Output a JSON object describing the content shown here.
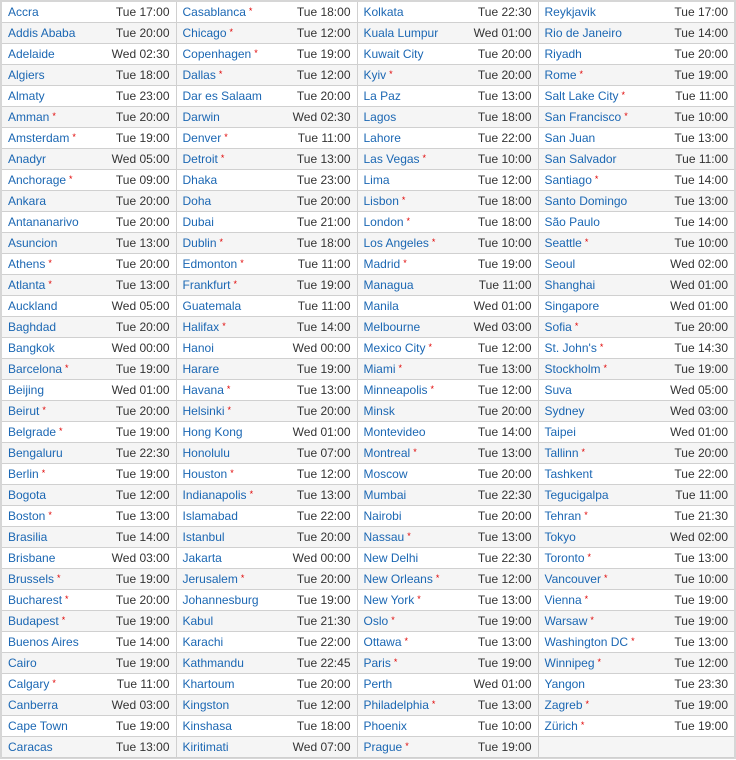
{
  "dst_marker": "*",
  "colors": {
    "link": "#1b67b3",
    "dst_marker": "#e00000",
    "row_alt": "#f5f5f5",
    "border": "#d0d0d0"
  },
  "columns": [
    [
      [
        "Accra",
        "Tue 17:00",
        false
      ],
      [
        "Addis Ababa",
        "Tue 20:00",
        false
      ],
      [
        "Adelaide",
        "Wed 02:30",
        false
      ],
      [
        "Algiers",
        "Tue 18:00",
        false
      ],
      [
        "Almaty",
        "Tue 23:00",
        false
      ],
      [
        "Amman",
        "Tue 20:00",
        true
      ],
      [
        "Amsterdam",
        "Tue 19:00",
        true
      ],
      [
        "Anadyr",
        "Wed 05:00",
        false
      ],
      [
        "Anchorage",
        "Tue 09:00",
        true
      ],
      [
        "Ankara",
        "Tue 20:00",
        false
      ],
      [
        "Antananarivo",
        "Tue 20:00",
        false
      ],
      [
        "Asuncion",
        "Tue 13:00",
        false
      ],
      [
        "Athens",
        "Tue 20:00",
        true
      ],
      [
        "Atlanta",
        "Tue 13:00",
        true
      ],
      [
        "Auckland",
        "Wed 05:00",
        false
      ],
      [
        "Baghdad",
        "Tue 20:00",
        false
      ],
      [
        "Bangkok",
        "Wed 00:00",
        false
      ],
      [
        "Barcelona",
        "Tue 19:00",
        true
      ],
      [
        "Beijing",
        "Wed 01:00",
        false
      ],
      [
        "Beirut",
        "Tue 20:00",
        true
      ],
      [
        "Belgrade",
        "Tue 19:00",
        true
      ],
      [
        "Bengaluru",
        "Tue 22:30",
        false
      ],
      [
        "Berlin",
        "Tue 19:00",
        true
      ],
      [
        "Bogota",
        "Tue 12:00",
        false
      ],
      [
        "Boston",
        "Tue 13:00",
        true
      ],
      [
        "Brasilia",
        "Tue 14:00",
        false
      ],
      [
        "Brisbane",
        "Wed 03:00",
        false
      ],
      [
        "Brussels",
        "Tue 19:00",
        true
      ],
      [
        "Bucharest",
        "Tue 20:00",
        true
      ],
      [
        "Budapest",
        "Tue 19:00",
        true
      ],
      [
        "Buenos Aires",
        "Tue 14:00",
        false
      ],
      [
        "Cairo",
        "Tue 19:00",
        false
      ],
      [
        "Calgary",
        "Tue 11:00",
        true
      ],
      [
        "Canberra",
        "Wed 03:00",
        false
      ],
      [
        "Cape Town",
        "Tue 19:00",
        false
      ],
      [
        "Caracas",
        "Tue 13:00",
        false
      ]
    ],
    [
      [
        "Casablanca",
        "Tue 18:00",
        true
      ],
      [
        "Chicago",
        "Tue 12:00",
        true
      ],
      [
        "Copenhagen",
        "Tue 19:00",
        true
      ],
      [
        "Dallas",
        "Tue 12:00",
        true
      ],
      [
        "Dar es Salaam",
        "Tue 20:00",
        false
      ],
      [
        "Darwin",
        "Wed 02:30",
        false
      ],
      [
        "Denver",
        "Tue 11:00",
        true
      ],
      [
        "Detroit",
        "Tue 13:00",
        true
      ],
      [
        "Dhaka",
        "Tue 23:00",
        false
      ],
      [
        "Doha",
        "Tue 20:00",
        false
      ],
      [
        "Dubai",
        "Tue 21:00",
        false
      ],
      [
        "Dublin",
        "Tue 18:00",
        true
      ],
      [
        "Edmonton",
        "Tue 11:00",
        true
      ],
      [
        "Frankfurt",
        "Tue 19:00",
        true
      ],
      [
        "Guatemala",
        "Tue 11:00",
        false
      ],
      [
        "Halifax",
        "Tue 14:00",
        true
      ],
      [
        "Hanoi",
        "Wed 00:00",
        false
      ],
      [
        "Harare",
        "Tue 19:00",
        false
      ],
      [
        "Havana",
        "Tue 13:00",
        true
      ],
      [
        "Helsinki",
        "Tue 20:00",
        true
      ],
      [
        "Hong Kong",
        "Wed 01:00",
        false
      ],
      [
        "Honolulu",
        "Tue 07:00",
        false
      ],
      [
        "Houston",
        "Tue 12:00",
        true
      ],
      [
        "Indianapolis",
        "Tue 13:00",
        true
      ],
      [
        "Islamabad",
        "Tue 22:00",
        false
      ],
      [
        "Istanbul",
        "Tue 20:00",
        false
      ],
      [
        "Jakarta",
        "Wed 00:00",
        false
      ],
      [
        "Jerusalem",
        "Tue 20:00",
        true
      ],
      [
        "Johannesburg",
        "Tue 19:00",
        false
      ],
      [
        "Kabul",
        "Tue 21:30",
        false
      ],
      [
        "Karachi",
        "Tue 22:00",
        false
      ],
      [
        "Kathmandu",
        "Tue 22:45",
        false
      ],
      [
        "Khartoum",
        "Tue 20:00",
        false
      ],
      [
        "Kingston",
        "Tue 12:00",
        false
      ],
      [
        "Kinshasa",
        "Tue 18:00",
        false
      ],
      [
        "Kiritimati",
        "Wed 07:00",
        false
      ]
    ],
    [
      [
        "Kolkata",
        "Tue 22:30",
        false
      ],
      [
        "Kuala Lumpur",
        "Wed 01:00",
        false
      ],
      [
        "Kuwait City",
        "Tue 20:00",
        false
      ],
      [
        "Kyiv",
        "Tue 20:00",
        true
      ],
      [
        "La Paz",
        "Tue 13:00",
        false
      ],
      [
        "Lagos",
        "Tue 18:00",
        false
      ],
      [
        "Lahore",
        "Tue 22:00",
        false
      ],
      [
        "Las Vegas",
        "Tue 10:00",
        true
      ],
      [
        "Lima",
        "Tue 12:00",
        false
      ],
      [
        "Lisbon",
        "Tue 18:00",
        true
      ],
      [
        "London",
        "Tue 18:00",
        true
      ],
      [
        "Los Angeles",
        "Tue 10:00",
        true
      ],
      [
        "Madrid",
        "Tue 19:00",
        true
      ],
      [
        "Managua",
        "Tue 11:00",
        false
      ],
      [
        "Manila",
        "Wed 01:00",
        false
      ],
      [
        "Melbourne",
        "Wed 03:00",
        false
      ],
      [
        "Mexico City",
        "Tue 12:00",
        true
      ],
      [
        "Miami",
        "Tue 13:00",
        true
      ],
      [
        "Minneapolis",
        "Tue 12:00",
        true
      ],
      [
        "Minsk",
        "Tue 20:00",
        false
      ],
      [
        "Montevideo",
        "Tue 14:00",
        false
      ],
      [
        "Montreal",
        "Tue 13:00",
        true
      ],
      [
        "Moscow",
        "Tue 20:00",
        false
      ],
      [
        "Mumbai",
        "Tue 22:30",
        false
      ],
      [
        "Nairobi",
        "Tue 20:00",
        false
      ],
      [
        "Nassau",
        "Tue 13:00",
        true
      ],
      [
        "New Delhi",
        "Tue 22:30",
        false
      ],
      [
        "New Orleans",
        "Tue 12:00",
        true
      ],
      [
        "New York",
        "Tue 13:00",
        true
      ],
      [
        "Oslo",
        "Tue 19:00",
        true
      ],
      [
        "Ottawa",
        "Tue 13:00",
        true
      ],
      [
        "Paris",
        "Tue 19:00",
        true
      ],
      [
        "Perth",
        "Wed 01:00",
        false
      ],
      [
        "Philadelphia",
        "Tue 13:00",
        true
      ],
      [
        "Phoenix",
        "Tue 10:00",
        false
      ],
      [
        "Prague",
        "Tue 19:00",
        true
      ]
    ],
    [
      [
        "Reykjavik",
        "Tue 17:00",
        false
      ],
      [
        "Rio de Janeiro",
        "Tue 14:00",
        false
      ],
      [
        "Riyadh",
        "Tue 20:00",
        false
      ],
      [
        "Rome",
        "Tue 19:00",
        true
      ],
      [
        "Salt Lake City",
        "Tue 11:00",
        true
      ],
      [
        "San Francisco",
        "Tue 10:00",
        true
      ],
      [
        "San Juan",
        "Tue 13:00",
        false
      ],
      [
        "San Salvador",
        "Tue 11:00",
        false
      ],
      [
        "Santiago",
        "Tue 14:00",
        true
      ],
      [
        "Santo Domingo",
        "Tue 13:00",
        false
      ],
      [
        "São Paulo",
        "Tue 14:00",
        false
      ],
      [
        "Seattle",
        "Tue 10:00",
        true
      ],
      [
        "Seoul",
        "Wed 02:00",
        false
      ],
      [
        "Shanghai",
        "Wed 01:00",
        false
      ],
      [
        "Singapore",
        "Wed 01:00",
        false
      ],
      [
        "Sofia",
        "Tue 20:00",
        true
      ],
      [
        "St. John's",
        "Tue 14:30",
        true
      ],
      [
        "Stockholm",
        "Tue 19:00",
        true
      ],
      [
        "Suva",
        "Wed 05:00",
        false
      ],
      [
        "Sydney",
        "Wed 03:00",
        false
      ],
      [
        "Taipei",
        "Wed 01:00",
        false
      ],
      [
        "Tallinn",
        "Tue 20:00",
        true
      ],
      [
        "Tashkent",
        "Tue 22:00",
        false
      ],
      [
        "Tegucigalpa",
        "Tue 11:00",
        false
      ],
      [
        "Tehran",
        "Tue 21:30",
        true
      ],
      [
        "Tokyo",
        "Wed 02:00",
        false
      ],
      [
        "Toronto",
        "Tue 13:00",
        true
      ],
      [
        "Vancouver",
        "Tue 10:00",
        true
      ],
      [
        "Vienna",
        "Tue 19:00",
        true
      ],
      [
        "Warsaw",
        "Tue 19:00",
        true
      ],
      [
        "Washington DC",
        "Tue 13:00",
        true
      ],
      [
        "Winnipeg",
        "Tue 12:00",
        true
      ],
      [
        "Yangon",
        "Tue 23:30",
        false
      ],
      [
        "Zagreb",
        "Tue 19:00",
        true
      ],
      [
        "Zürich",
        "Tue 19:00",
        true
      ]
    ]
  ]
}
